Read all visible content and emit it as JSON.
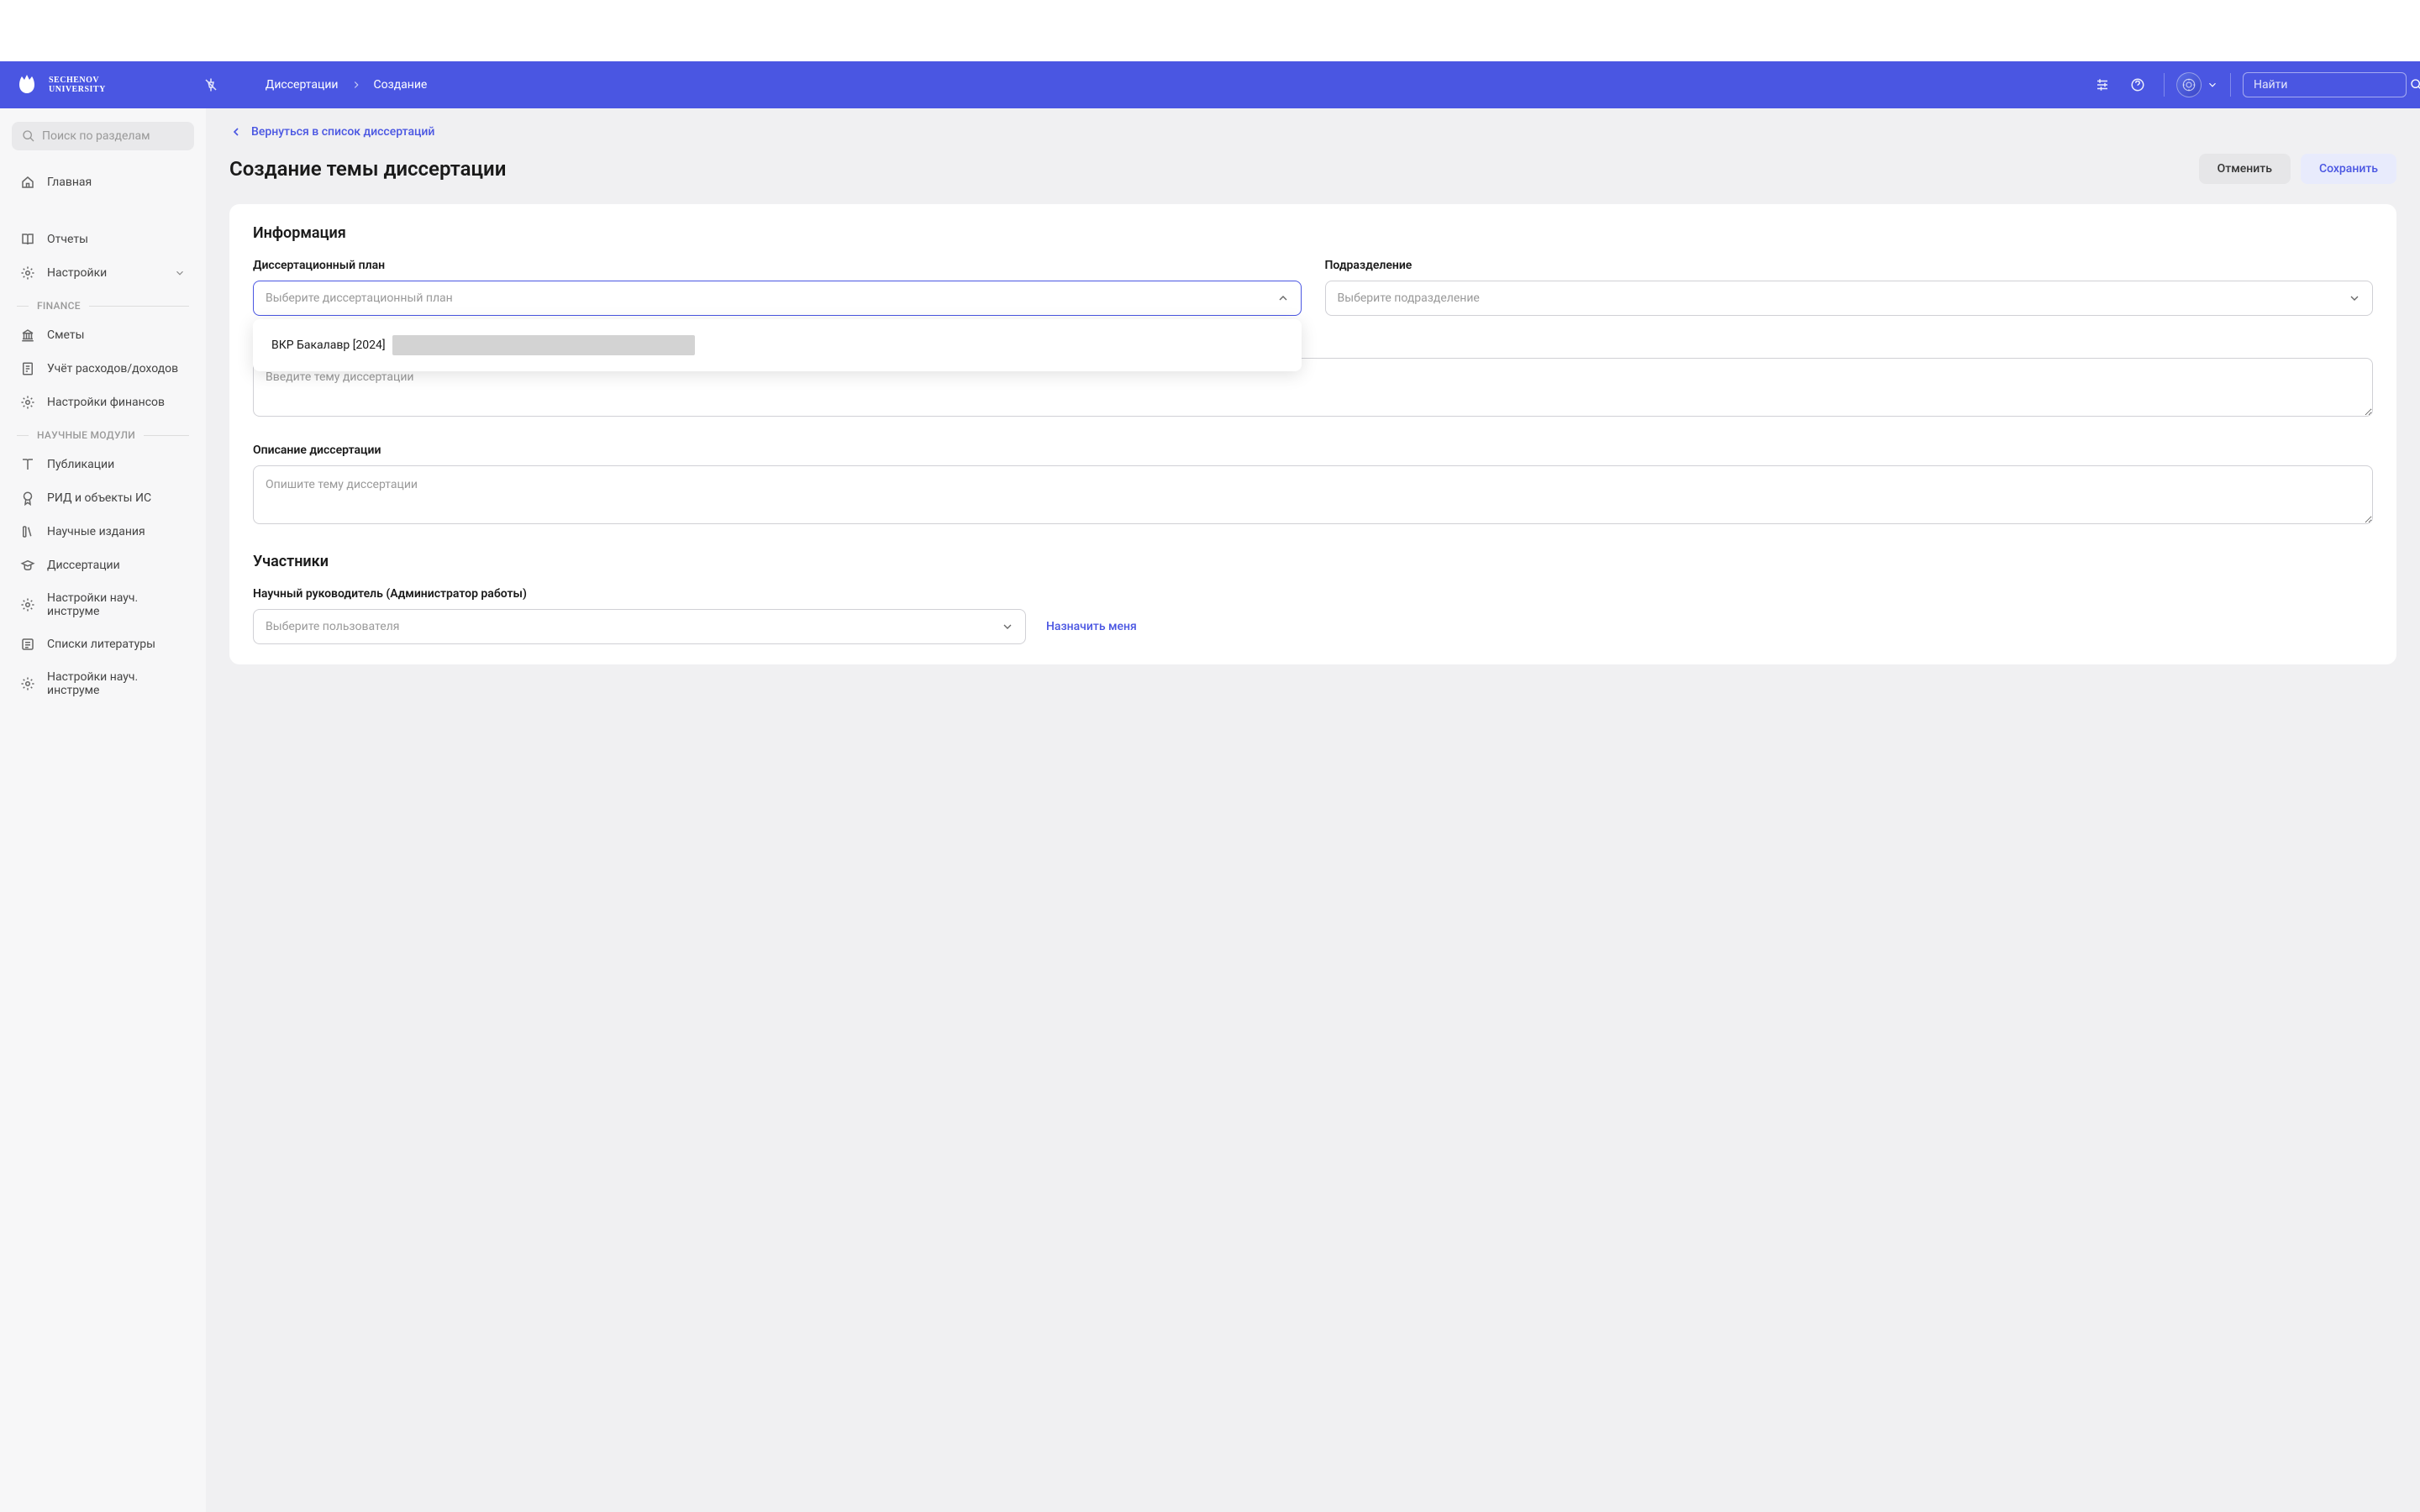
{
  "header": {
    "logo_line1": "SECHENOV",
    "logo_line2": "UNIVERSITY",
    "breadcrumb": [
      "Диссертации",
      "Создание"
    ],
    "search_placeholder": "Найти"
  },
  "sidebar": {
    "search_placeholder": "Поиск по разделам",
    "top_items": [
      {
        "label": "Главная"
      },
      {
        "label": "Отчеты"
      },
      {
        "label": "Настройки",
        "has_chevron": true
      }
    ],
    "groups": [
      {
        "label": "FINANCE",
        "items": [
          {
            "label": "Сметы"
          },
          {
            "label": "Учёт расходов/доходов"
          },
          {
            "label": "Настройки финансов"
          }
        ]
      },
      {
        "label": "НАУЧНЫЕ МОДУЛИ",
        "items": [
          {
            "label": "Публикации"
          },
          {
            "label": "РИД и объекты ИС"
          },
          {
            "label": "Научные издания"
          },
          {
            "label": "Диссертации"
          },
          {
            "label": "Настройки науч. инструме"
          },
          {
            "label": "Списки литературы"
          },
          {
            "label": "Настройки науч. инструме"
          }
        ]
      }
    ]
  },
  "main": {
    "back_label": "Вернуться в список диссертаций",
    "page_title": "Создание темы диссертации",
    "cancel_label": "Отменить",
    "save_label": "Сохранить",
    "info_title": "Информация",
    "fields": {
      "plan_label": "Диссертационный план",
      "plan_placeholder": "Выберите диссертационный план",
      "plan_option": "ВКР Бакалавр [2024]",
      "department_label": "Подразделение",
      "department_placeholder": "Выберите подразделение",
      "topic_placeholder": "Введите тему диссертации",
      "description_label": "Описание диссертации",
      "description_placeholder": "Опишите тему диссертации"
    },
    "participants": {
      "title": "Участники",
      "supervisor_label": "Научный руководитель (Администратор работы)",
      "user_placeholder": "Выберите пользователя",
      "assign_me": "Назначить меня"
    }
  }
}
